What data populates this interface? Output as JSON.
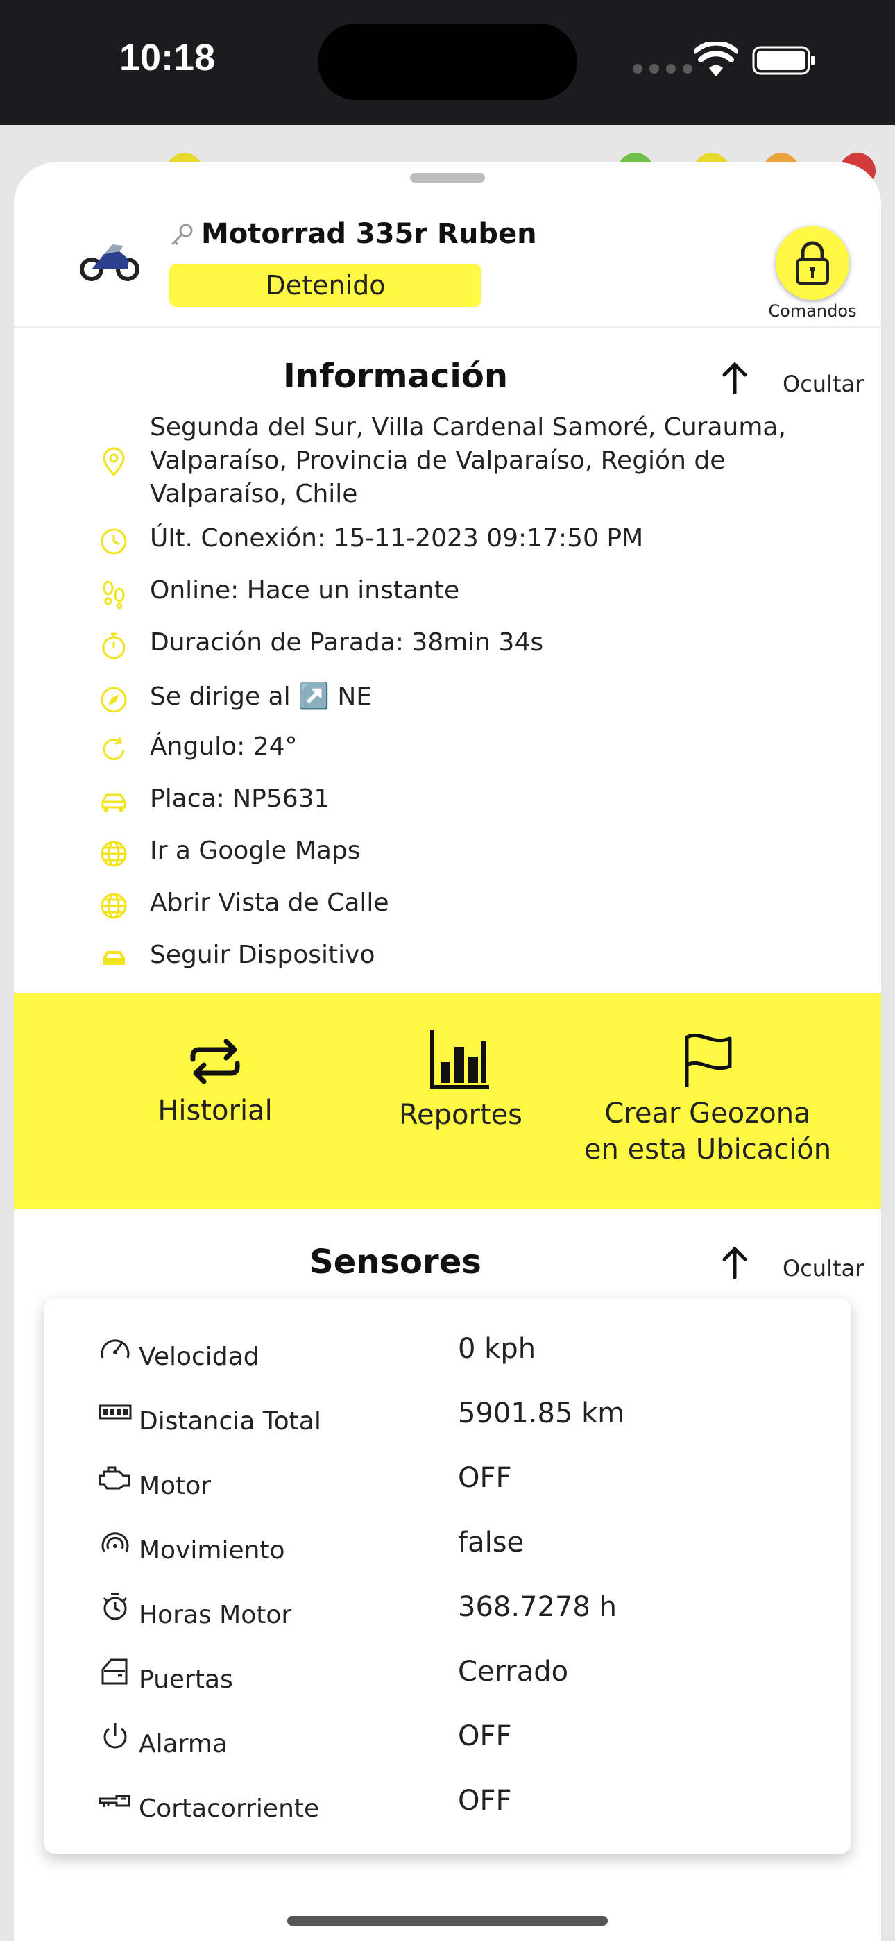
{
  "status_bar": {
    "time": "10:18"
  },
  "device": {
    "name": "Motorrad 335r Ruben",
    "status": "Detenido",
    "status_color": "#fff944"
  },
  "commands": {
    "label": "Comandos"
  },
  "info": {
    "title": "Información",
    "hide_label": "Ocultar",
    "rows": [
      {
        "icon": "location-pin-icon",
        "text": "Segunda del Sur, Villa Cardenal Samoré, Curauma, Valparaíso, Provincia de Valparaíso, Región de Valparaíso, Chile"
      },
      {
        "icon": "clock-icon",
        "text": "Últ. Conexión: 15-11-2023 09:17:50 PM"
      },
      {
        "icon": "footsteps-icon",
        "text": "Online: Hace un instante"
      },
      {
        "icon": "stopwatch-icon",
        "text": "Duración de Parada: 38min 34s"
      },
      {
        "icon": "compass-icon",
        "text": "Se dirige al ↗️ NE"
      },
      {
        "icon": "rotate-icon",
        "text": "Ángulo: 24°"
      },
      {
        "icon": "car-icon",
        "text": "Placa: NP5631"
      },
      {
        "icon": "globe-icon",
        "text": "Ir a Google Maps"
      },
      {
        "icon": "globe-icon",
        "text": "Abrir Vista de Calle"
      },
      {
        "icon": "car-follow-icon",
        "text": "Seguir Dispositivo"
      }
    ]
  },
  "actions": {
    "history": "Historial",
    "reports": "Reportes",
    "geofence_line1": "Crear Geozona",
    "geofence_line2": "en esta Ubicación"
  },
  "sensors": {
    "title": "Sensores",
    "hide_label": "Ocultar",
    "rows": [
      {
        "icon": "speedometer-icon",
        "name": "Velocidad",
        "value": "0 kph"
      },
      {
        "icon": "odometer-icon",
        "name": "Distancia Total",
        "value": "5901.85 km"
      },
      {
        "icon": "engine-icon",
        "name": "Motor",
        "value": "OFF"
      },
      {
        "icon": "motion-icon",
        "name": "Movimiento",
        "value": "false"
      },
      {
        "icon": "engine-hours-icon",
        "name": "Horas Motor",
        "value": "368.7278 h"
      },
      {
        "icon": "door-icon",
        "name": "Puertas",
        "value": "Cerrado"
      },
      {
        "icon": "power-icon",
        "name": "Alarma",
        "value": "OFF"
      },
      {
        "icon": "cutoff-key-icon",
        "name": "Cortacorriente",
        "value": "OFF"
      }
    ]
  },
  "colors": {
    "accent": "#fff944",
    "icon_yellow": "#f2e41c"
  }
}
